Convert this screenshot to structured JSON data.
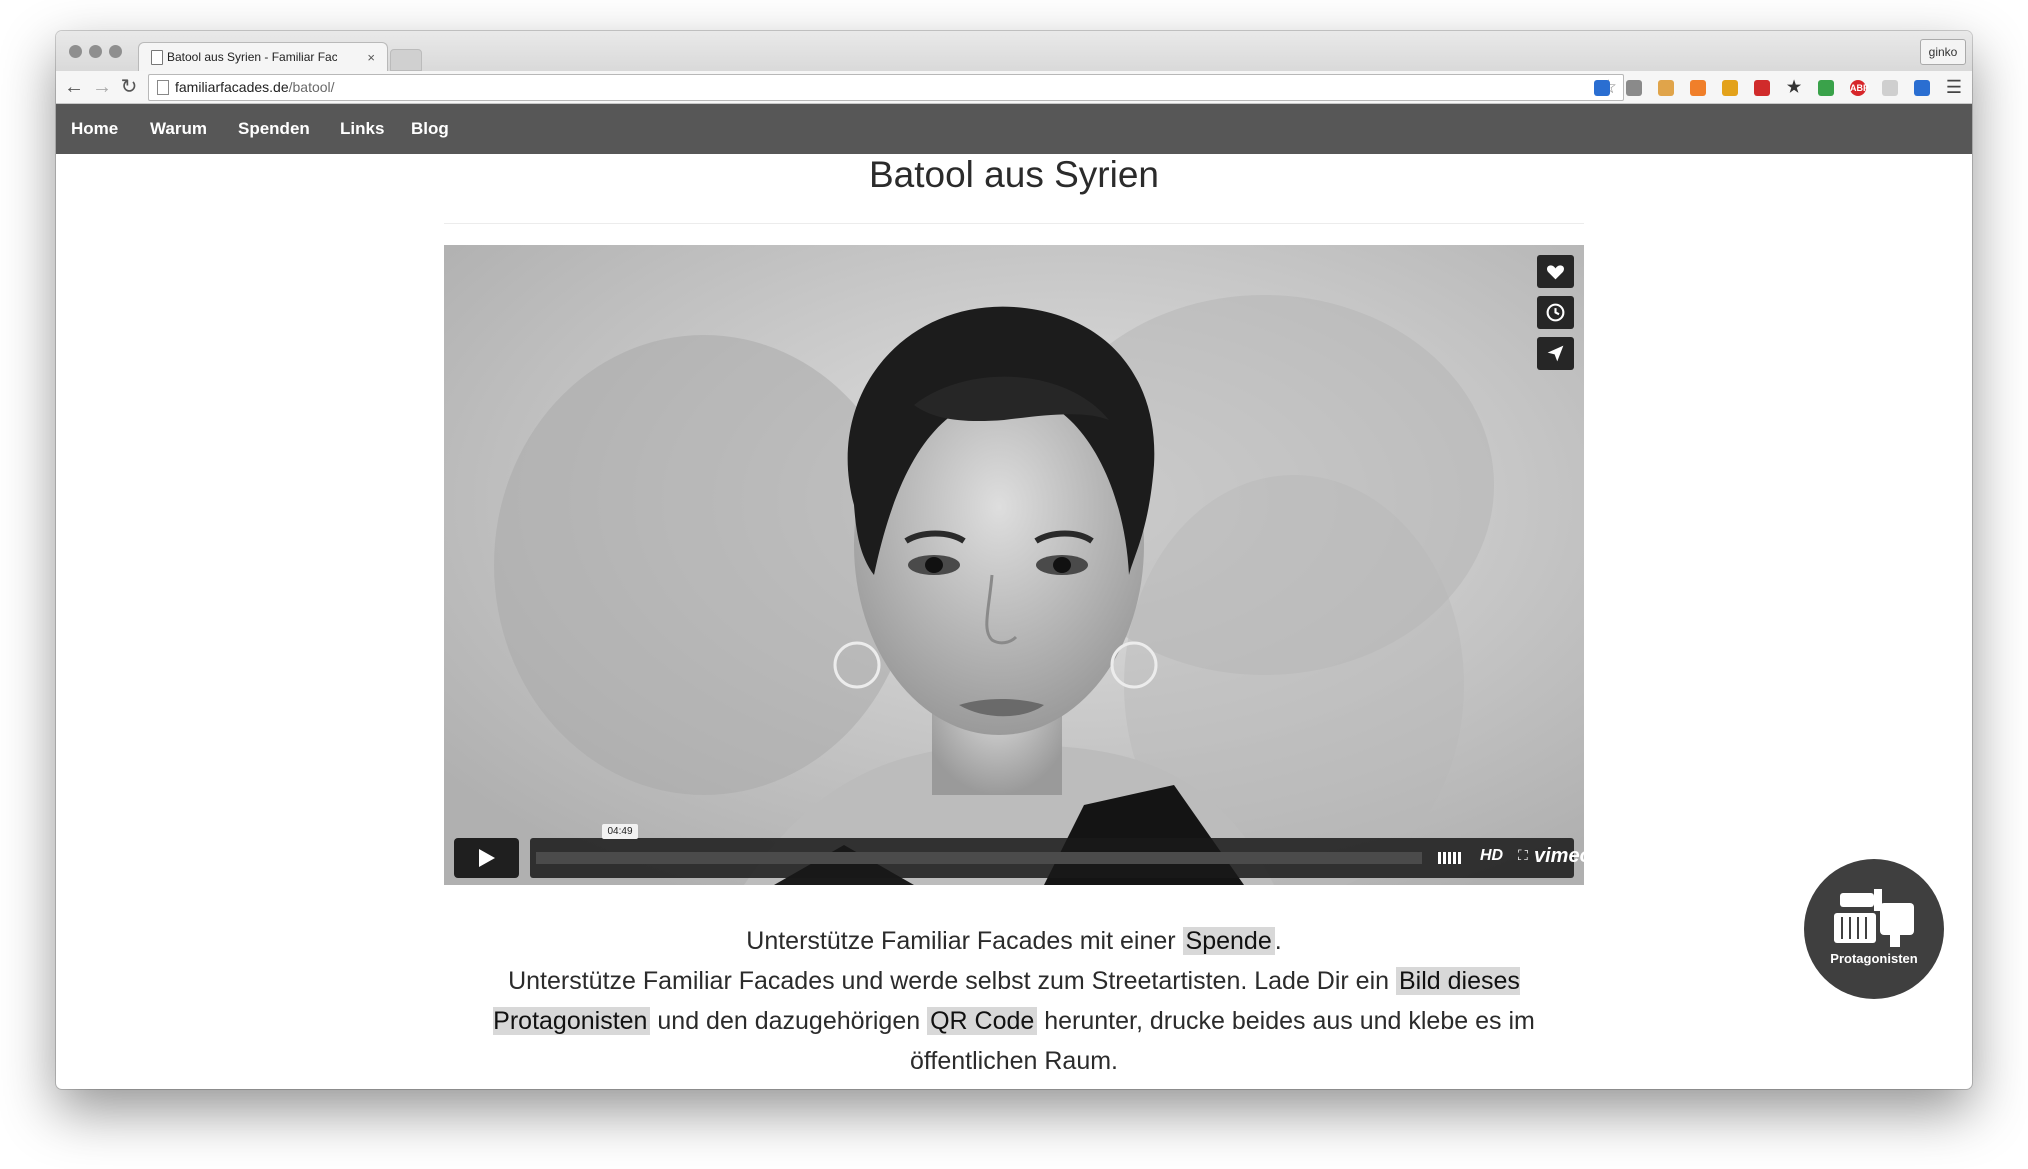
{
  "browser": {
    "tab_title": "Batool aus Syrien - Familiar Facades",
    "tab_close": "×",
    "user_label": "ginko",
    "url_host": "familiarfacades.de",
    "url_path": "/batool/",
    "extension_abp": "ABP"
  },
  "site": {
    "nav": [
      "Home",
      "Warum",
      "Spenden",
      "Links",
      "Blog"
    ],
    "title": "Batool aus Syrien"
  },
  "video": {
    "timecode": "04:49",
    "hd_label": "HD",
    "brand": "vimeo",
    "progress": 0.0,
    "actions": [
      "heart-icon",
      "clock-icon",
      "send-icon"
    ]
  },
  "content": {
    "line1_text": "Unterstütze Familiar Facades mit einer ",
    "line1_link": "Spende",
    "line1_end": ".",
    "p2_a": "Unterstütze Familiar Facades und werde selbst zum Streetartisten. Lade Dir ein ",
    "p2_link1": "Bild dieses Protagonisten",
    "p2_b": " und den dazugehörigen ",
    "p2_link2": "QR Code",
    "p2_c": " herunter, drucke beides aus und klebe es im öffentlichen Raum."
  },
  "fab": {
    "label": "Protagonisten"
  }
}
